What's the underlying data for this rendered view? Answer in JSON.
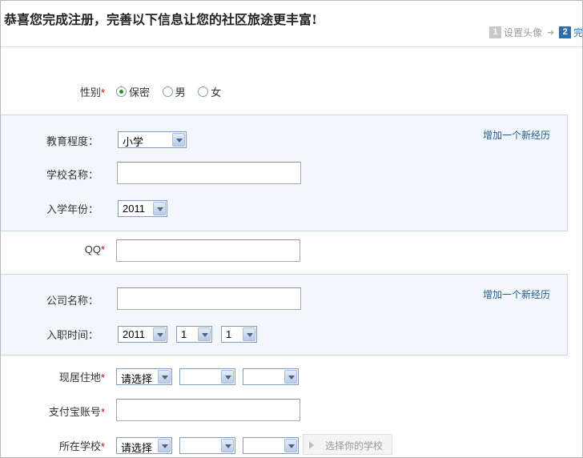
{
  "header": {
    "title": "恭喜您完成注册，完善以下信息让您的社区旅途更丰富!",
    "steps": [
      {
        "num": "1",
        "label": "设置头像"
      },
      {
        "num": "2",
        "label": "完"
      }
    ]
  },
  "gender": {
    "label": "性别",
    "required": "*",
    "options": [
      "保密",
      "男",
      "女"
    ],
    "selected": "保密"
  },
  "education": {
    "level_label": "教育程度：",
    "level_value": "小学",
    "school_label": "学校名称：",
    "school_value": "",
    "year_label": "入学年份：",
    "year_value": "2011",
    "add_link": "增加一个新经历"
  },
  "qq": {
    "label": "QQ",
    "required": "*",
    "value": ""
  },
  "work": {
    "company_label": "公司名称：",
    "company_value": "",
    "date_label": "入职时间：",
    "year_value": "2011",
    "month_value": "1",
    "day_value": "1",
    "add_link": "增加一个新经历"
  },
  "residence": {
    "label": "现居住地",
    "required": "*",
    "province": "请选择",
    "city": "",
    "district": ""
  },
  "alipay": {
    "label": "支付宝账号",
    "required": "*",
    "value": ""
  },
  "school": {
    "label": "所在学校",
    "required": "*",
    "province": "请选择",
    "city": "",
    "district": "",
    "choose_button": "选择你的学校"
  }
}
